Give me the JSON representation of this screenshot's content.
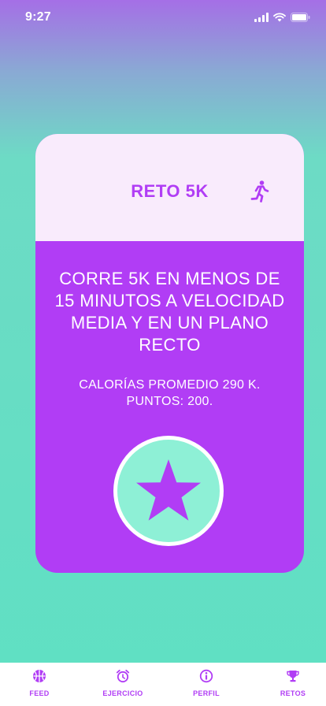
{
  "status_bar": {
    "time": "9:27",
    "icons": [
      "signal-icon",
      "wifi-icon",
      "battery-icon"
    ]
  },
  "challenge": {
    "title": "RETO 5K",
    "icon": "running-person-icon",
    "description": "CORRE 5K EN MENOS DE 15 MINUTOS A VELOCIDAD MEDIA Y EN UN PLANO RECTO",
    "calories_line": "CALORÍAS PROMEDIO 290 K.",
    "points_line": "PUNTOS: 200.",
    "action_icon": "star-icon"
  },
  "tab_bar": {
    "tabs": [
      {
        "label": "FEED",
        "icon": "basketball-icon"
      },
      {
        "label": "EJERCICIO",
        "icon": "alarm-clock-icon"
      },
      {
        "label": "PERFIL",
        "icon": "info-circle-icon"
      },
      {
        "label": "RETOS",
        "icon": "trophy-icon"
      }
    ]
  },
  "colors": {
    "accent": "#b13df5",
    "card_header_bg": "#f9ebfc",
    "star_circle_bg": "#8ef0d6",
    "background_bottom": "#5fe0c3",
    "background_top": "#a56fe6"
  }
}
